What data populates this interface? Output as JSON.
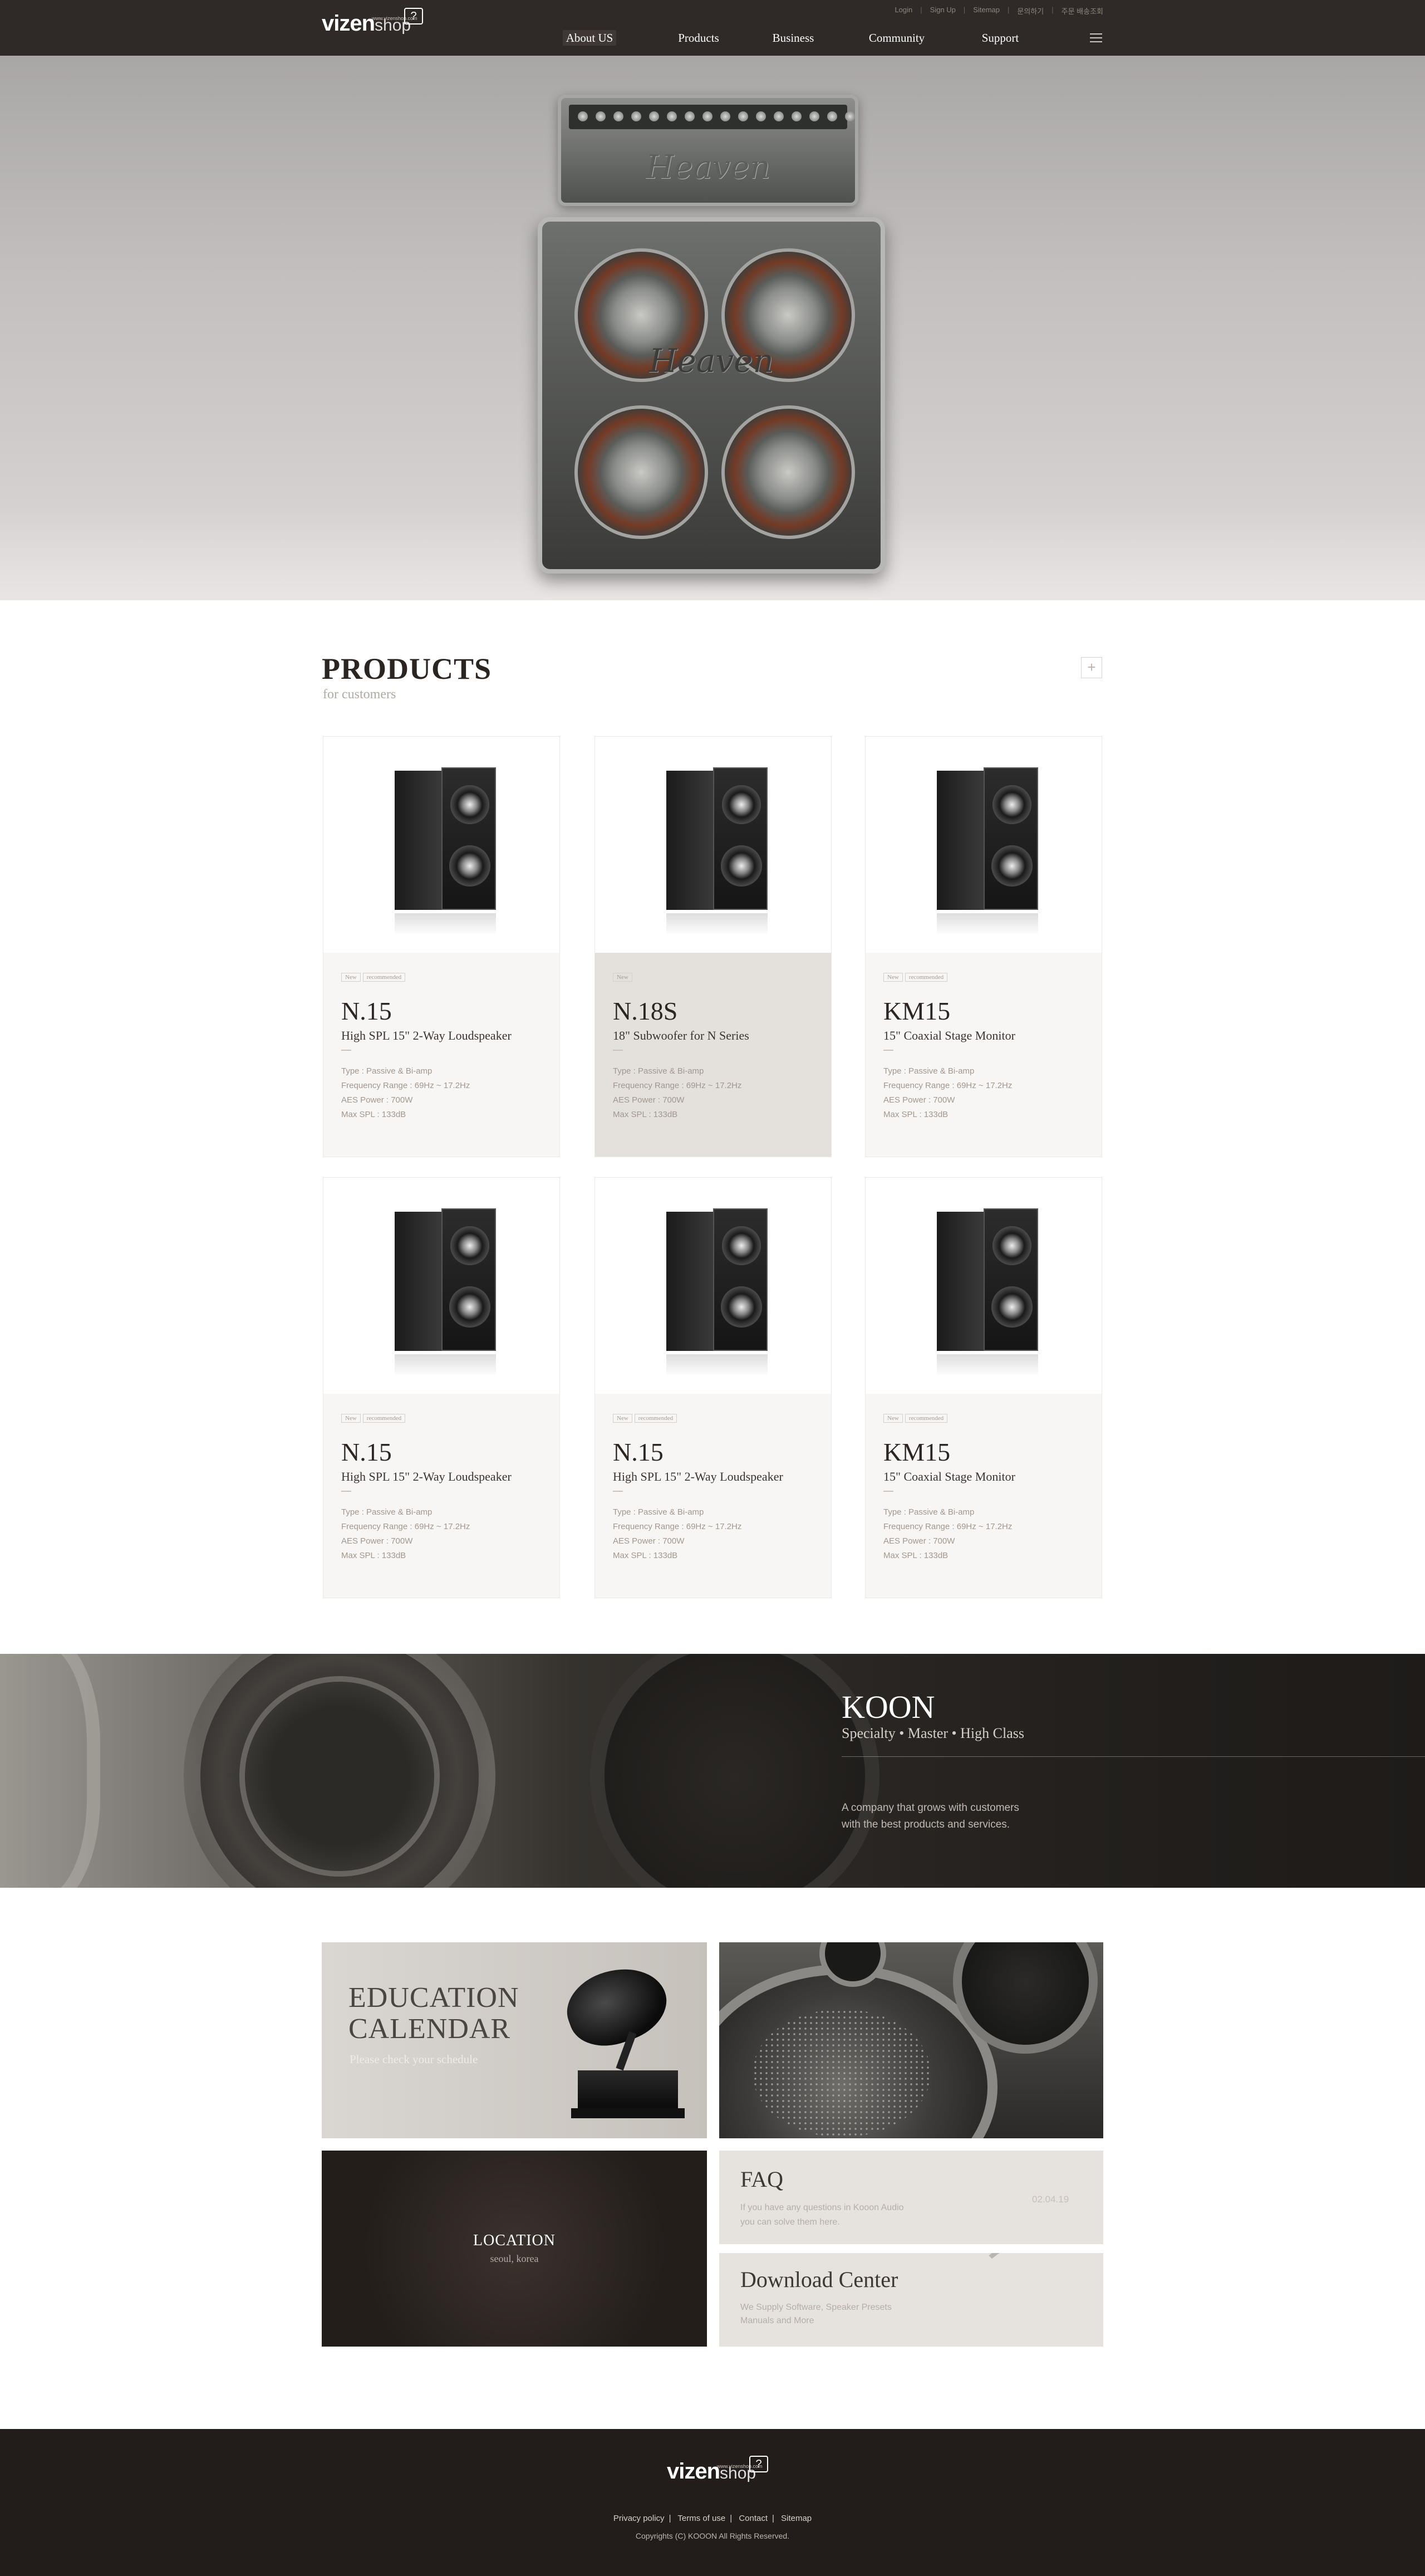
{
  "header": {
    "logo_main": "vizen",
    "logo_sub": "shop",
    "logo_tag": "www.vizenshop.com",
    "logo_badge": "?",
    "util_links": [
      "Login",
      "Sign Up",
      "Sitemap",
      "문의하기",
      "주문 배송조회"
    ],
    "nav": [
      "About US",
      "Products",
      "Business",
      "Community",
      "Support"
    ]
  },
  "hero": {
    "amp_logo": "Heaven",
    "cab_logo": "Heaven"
  },
  "products": {
    "title": "PRODUCTS",
    "subtitle": "for customers",
    "more_label": "+",
    "badge_new": "New",
    "badge_rec": "recommended",
    "items": [
      {
        "name": "N.15",
        "desc": "High SPL 15\" 2-Way Loudspeaker",
        "specs": [
          "Type : Passive & Bi-amp",
          "Frequency Range : 69Hz ~ 17.2Hz",
          "AES Power : 700W",
          "Max SPL : 133dB"
        ],
        "badges": [
          "New",
          "recommended"
        ]
      },
      {
        "name": "N.18S",
        "desc": "18\" Subwoofer for N Series",
        "specs": [
          "Type : Passive & Bi-amp",
          "Frequency Range : 69Hz ~ 17.2Hz",
          "AES Power : 700W",
          "Max SPL : 133dB"
        ],
        "badges": [
          "New"
        ]
      },
      {
        "name": "KM15",
        "desc": "15\" Coaxial Stage Monitor",
        "specs": [
          "Type : Passive & Bi-amp",
          "Frequency Range : 69Hz ~ 17.2Hz",
          "AES Power : 700W",
          "Max SPL : 133dB"
        ],
        "badges": [
          "New",
          "recommended"
        ]
      },
      {
        "name": "N.15",
        "desc": "High SPL 15\" 2-Way Loudspeaker",
        "specs": [
          "Type : Passive & Bi-amp",
          "Frequency Range : 69Hz ~ 17.2Hz",
          "AES Power : 700W",
          "Max SPL : 133dB"
        ],
        "badges": [
          "New",
          "recommended"
        ]
      },
      {
        "name": "N.15",
        "desc": "High SPL 15\" 2-Way Loudspeaker",
        "specs": [
          "Type : Passive & Bi-amp",
          "Frequency Range : 69Hz ~ 17.2Hz",
          "AES Power : 700W",
          "Max SPL : 133dB"
        ],
        "badges": [
          "New",
          "recommended"
        ]
      },
      {
        "name": "KM15",
        "desc": "15\" Coaxial Stage Monitor",
        "specs": [
          "Type : Passive & Bi-amp",
          "Frequency Range : 69Hz ~ 17.2Hz",
          "AES Power : 700W",
          "Max SPL : 133dB"
        ],
        "badges": [
          "New",
          "recommended"
        ]
      }
    ]
  },
  "koon": {
    "title": "KOON",
    "subtitle": "Specialty • Master • High Class",
    "text_line1": "A company that grows with customers",
    "text_line2": "with the best products and services."
  },
  "tiles": {
    "edu_title_1": "EDUCATION",
    "edu_title_2": "CALENDAR",
    "edu_sub": "Please check your schedule",
    "loc_title": "LOCATION",
    "loc_sub": "seoul, korea",
    "faq_title": "FAQ",
    "faq_line1": "If you have any questions in Kooon Audio",
    "faq_line2": "you can solve them here.",
    "faq_date": "02.04.19",
    "dl_title": "Download Center",
    "dl_line1": "We Supply Software, Speaker Presets",
    "dl_line2": "Manuals and More"
  },
  "footer": {
    "links": [
      "Privacy policy",
      "Terms of use",
      "Contact",
      "Sitemap"
    ],
    "copyright": "Copyrights (C) KOOON All Rights Reserved."
  }
}
